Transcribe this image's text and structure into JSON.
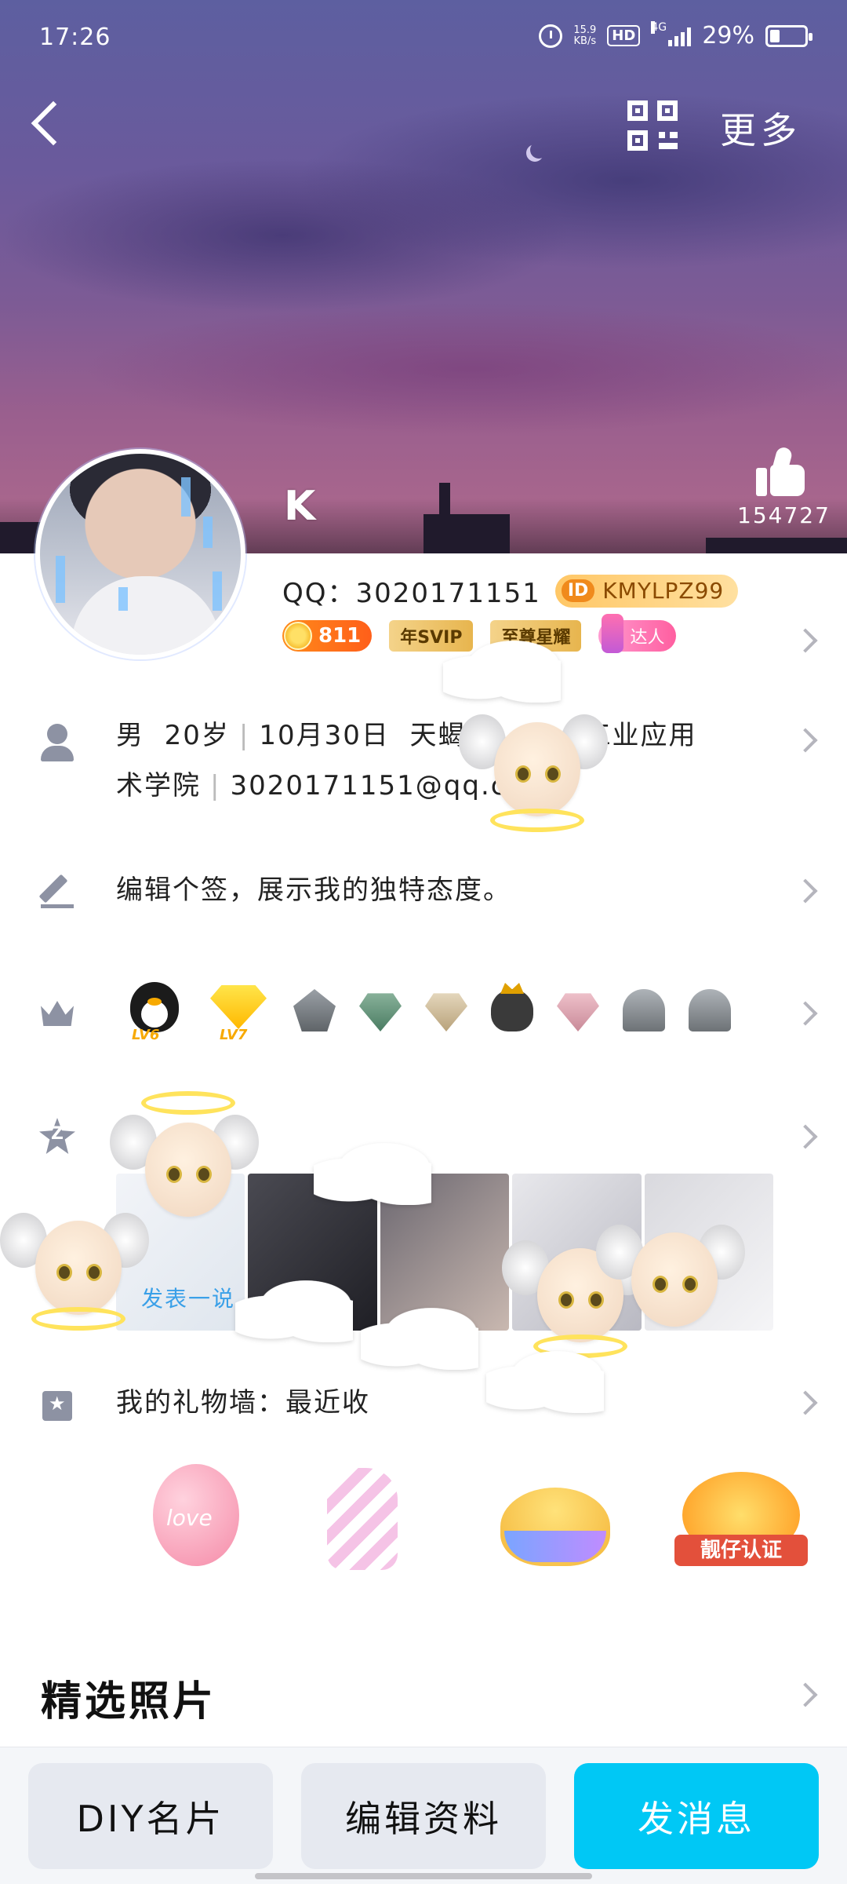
{
  "status_bar": {
    "time": "17:26",
    "net_speed": "15.9",
    "net_unit": "KB/s",
    "hd": "HD",
    "network": "4G",
    "battery": "29%",
    "battery_level": 0.29
  },
  "header": {
    "more_label": "更多",
    "like_count": "154727"
  },
  "profile": {
    "name": "K",
    "qq_label": "QQ：3020171151",
    "id_mark": "ID",
    "id_value": "KMYLPZ99",
    "coin_count": "811",
    "svip_label": "年SVIP",
    "star_label": "至尊星耀",
    "talent_label": "达人"
  },
  "info": {
    "line1_gender": "男",
    "line1_age": "20岁",
    "line1_birthday": "10月30日",
    "line1_rest": "天蝎",
    "line1_school": "工业应用",
    "line2_school": "术学院",
    "line2_email": "3020171151@qq.co"
  },
  "signature": "编辑个签，展示我的独特态度。",
  "badges": {
    "penguin_lv": "LV6",
    "diamond_lv": "LV7"
  },
  "zone": {
    "post_label": "发表一说"
  },
  "gifts": {
    "row_label": "我的礼物墙：最近收",
    "balloon_text": "love",
    "badge_text": "靓仔认证"
  },
  "section": {
    "title": "精选照片"
  },
  "bottom_bar": {
    "diy_label": "DIY名片",
    "edit_label": "编辑资料",
    "message_label": "发消息"
  },
  "colors": {
    "accent": "#00c8f5",
    "chevron": "#b5b5bd",
    "icon_grey": "#8d92a3"
  }
}
